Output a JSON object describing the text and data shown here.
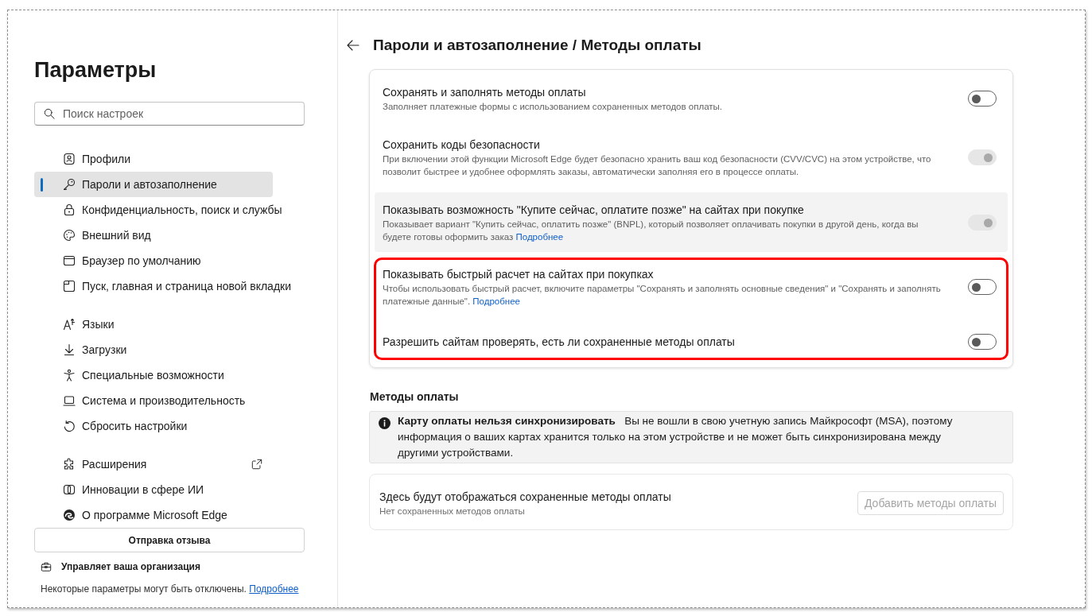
{
  "sidebar": {
    "title": "Параметры",
    "search": {
      "placeholder": "Поиск настроек"
    },
    "nav_groups": [
      {
        "items": [
          {
            "label": "Профили",
            "selected": false,
            "external": false
          },
          {
            "label": "Пароли и автозаполнение",
            "selected": true,
            "external": false
          },
          {
            "label": "Конфиденциальность, поиск и службы",
            "selected": false,
            "external": false
          },
          {
            "label": "Внешний вид",
            "selected": false,
            "external": false
          },
          {
            "label": "Браузер по умолчанию",
            "selected": false,
            "external": false
          },
          {
            "label": "Пуск, главная и страница новой вкладки",
            "selected": false,
            "external": false
          }
        ]
      },
      {
        "items": [
          {
            "label": "Языки",
            "selected": false,
            "external": false
          },
          {
            "label": "Загрузки",
            "selected": false,
            "external": false
          },
          {
            "label": "Специальные возможности",
            "selected": false,
            "external": false
          },
          {
            "label": "Система и производительность",
            "selected": false,
            "external": false
          },
          {
            "label": "Сбросить настройки",
            "selected": false,
            "external": false
          }
        ]
      },
      {
        "items": [
          {
            "label": "Расширения",
            "selected": false,
            "external": true
          },
          {
            "label": "Инновации в сфере ИИ",
            "selected": false,
            "external": false
          },
          {
            "label": "О программе Microsoft Edge",
            "selected": false,
            "external": false
          }
        ]
      }
    ],
    "feedback_button": "Отправка отзыва",
    "managed_notice": "Управляет ваша организация",
    "disabled_notice": {
      "text": "Некоторые параметры могут быть отключены.",
      "link": "Подробнее"
    }
  },
  "main": {
    "title": "Пароли и автозаполнение / Методы оплаты",
    "settings": [
      {
        "title": "Сохранять и заполнять методы оплаты",
        "description": "Заполняет платежные формы с использованием сохраненных методов оплаты.",
        "on": false,
        "disabled": false,
        "highlighted": false,
        "outlined": false
      },
      {
        "title": "Сохранить коды безопасности",
        "description": "При включении этой функции Microsoft Edge будет безопасно хранить ваш код безопасности (CVV/CVC) на этом устройстве, что позволит быстрее и удобнее оформлять заказы, автоматически заполняя его в процессе оплаты.",
        "on": true,
        "disabled": true,
        "highlighted": false,
        "outlined": false
      },
      {
        "title": "Показывать возможность \"Купите сейчас, оплатите позже\" на сайтах при покупке",
        "description": "Показывает вариант \"Купить сейчас, оплатить позже\" (BNPL), который позволяет оплачивать покупки в другой день, когда вы будете готовы оформить заказ",
        "link": "Подробнее",
        "on": true,
        "disabled": true,
        "highlighted": true,
        "outlined": false
      },
      {
        "title": "Показывать быстрый расчет на сайтах при покупках",
        "description": "Чтобы использовать быстрый расчет, включите параметры \"Сохранять и заполнять основные сведения\" и \"Сохранять и заполнять платежные данные\".",
        "link": "Подробнее",
        "on": false,
        "disabled": false,
        "highlighted": false,
        "outlined": true
      },
      {
        "title": "Разрешить сайтам проверять, есть ли сохраненные методы оплаты",
        "on": false,
        "disabled": false,
        "highlighted": false,
        "outlined": true
      }
    ],
    "payment_methods": {
      "heading": "Методы оплаты",
      "info_banner": "**Карту оплаты нельзя синхронизировать**   Вы не вошли в свою учетную запись Майкрософт (MSA), поэтому информация о ваших картах хранится только на этом устройстве и не может быть синхронизирована между другими устройствами.",
      "saved": {
        "title": "Здесь будут отображаться сохраненные методы оплаты",
        "subtitle": "Нет сохраненных методов оплаты",
        "button": {
          "label": "Добавить методы оплаты",
          "disabled": true
        }
      }
    }
  }
}
